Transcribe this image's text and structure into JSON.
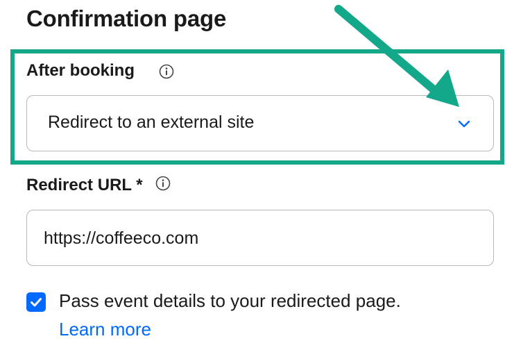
{
  "page_title": "Confirmation page",
  "after_booking": {
    "label": "After booking",
    "info_icon": "info-circle-icon",
    "selected_value": "Redirect to an external site",
    "chevron_icon": "chevron-down-icon"
  },
  "redirect_url": {
    "label": "Redirect URL *",
    "info_icon": "info-circle-icon",
    "value": "https://coffeeco.com"
  },
  "pass_details": {
    "checked": true,
    "label": "Pass event details to your redirected page.",
    "link_text": "Learn more"
  },
  "annotation": {
    "highlight_color": "#14a88a",
    "arrow_color": "#14a88a"
  },
  "colors": {
    "accent": "#0069ff",
    "text": "#1a1a1a",
    "border": "#b8b8b8"
  }
}
